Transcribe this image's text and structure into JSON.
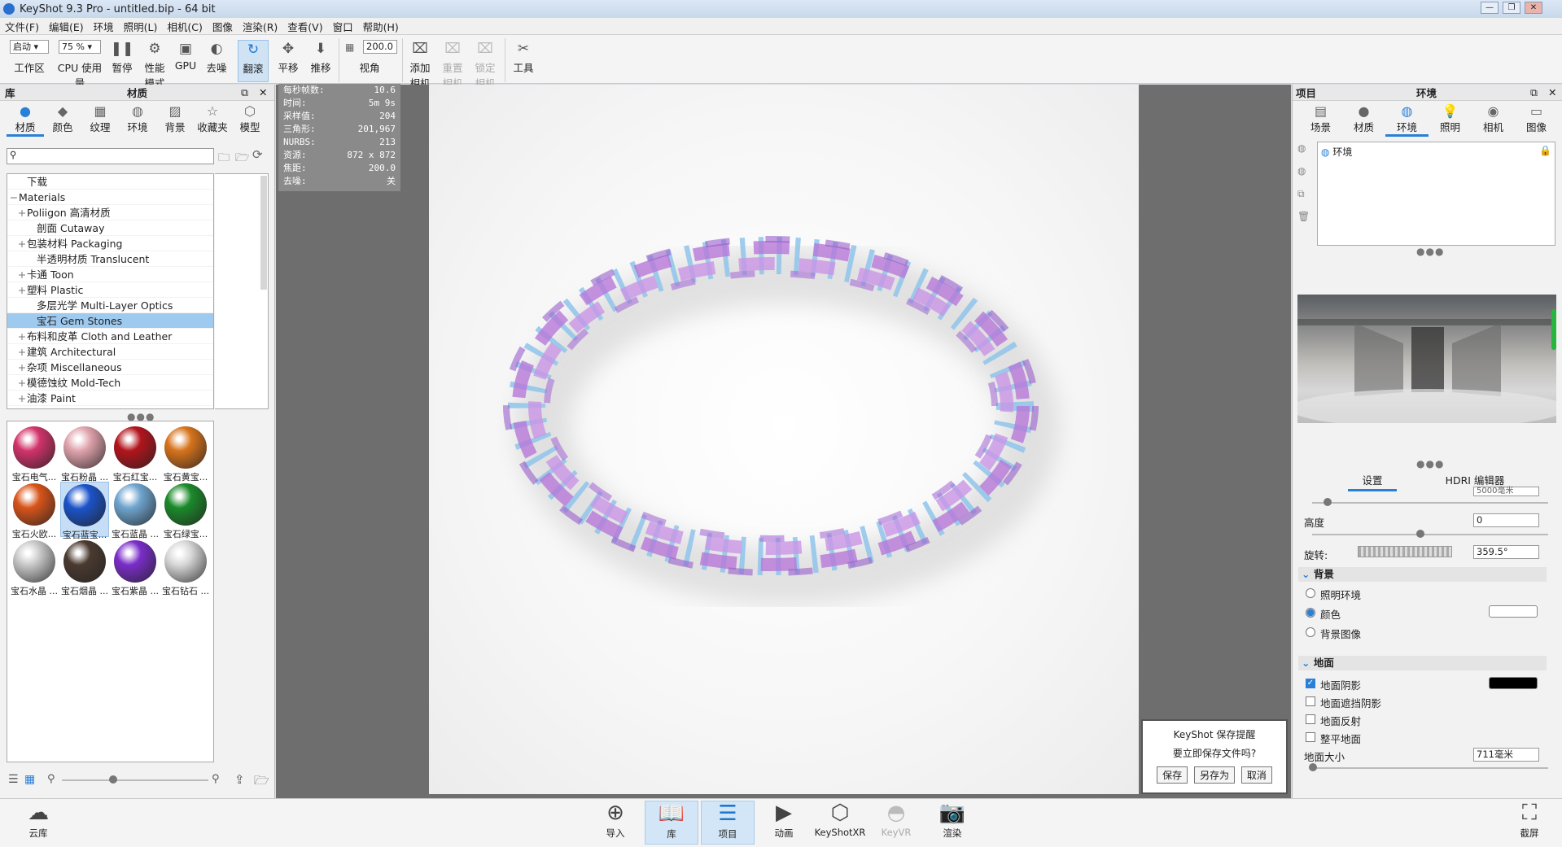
{
  "window": {
    "title": "KeyShot 9.3 Pro  - untitled.bip  - 64 bit"
  },
  "menu": [
    "文件(F)",
    "编辑(E)",
    "环境",
    "照明(L)",
    "相机(C)",
    "图像",
    "渲染(R)",
    "查看(V)",
    "窗口",
    "帮助(H)"
  ],
  "toolbar": {
    "workspace_select": "启动",
    "workspace_label": "工作区",
    "cpu_select": "75 %",
    "cpu_label": "CPU 使用量",
    "pause": "暂停",
    "perf_l1": "性能",
    "perf_l2": "模式",
    "gpu": "GPU",
    "denoise": "去噪",
    "tumble": "翻滚",
    "pan": "平移",
    "dolly": "推移",
    "fov_value": "200.0",
    "fov_label": "视角",
    "add_cam_l1": "添加",
    "add_cam_l2": "相机",
    "reset_cam_l1": "重置",
    "reset_cam_l2": "相机",
    "lock_cam_l1": "锁定",
    "lock_cam_l2": "相机",
    "tools": "工具"
  },
  "library": {
    "header_left": "库",
    "header_title": "材质",
    "tabs": [
      "材质",
      "颜色",
      "纹理",
      "环境",
      "背景",
      "收藏夹",
      "模型"
    ],
    "tree": [
      {
        "label": "下载",
        "plus": false,
        "indent": 1
      },
      {
        "label": "Materials",
        "plus": false,
        "indent": 0,
        "minus": true
      },
      {
        "label": "Poliigon 高清材质",
        "plus": true,
        "indent": 1
      },
      {
        "label": "剖面 Cutaway",
        "plus": false,
        "indent": 2
      },
      {
        "label": "包装材料 Packaging",
        "plus": true,
        "indent": 1
      },
      {
        "label": "半透明材质 Translucent",
        "plus": false,
        "indent": 2
      },
      {
        "label": "卡通 Toon",
        "plus": true,
        "indent": 1
      },
      {
        "label": "塑料 Plastic",
        "plus": true,
        "indent": 1
      },
      {
        "label": "多层光学 Multi-Layer Optics",
        "plus": false,
        "indent": 2
      },
      {
        "label": "宝石 Gem Stones",
        "plus": false,
        "indent": 2,
        "selected": true
      },
      {
        "label": "布料和皮革 Cloth and Leather",
        "plus": true,
        "indent": 1
      },
      {
        "label": "建筑 Architectural",
        "plus": true,
        "indent": 1
      },
      {
        "label": "杂项 Miscellaneous",
        "plus": true,
        "indent": 1
      },
      {
        "label": "模德蚀纹 Mold-Tech",
        "plus": true,
        "indent": 1
      },
      {
        "label": "油漆 Paint",
        "plus": true,
        "indent": 1
      }
    ],
    "swatches": [
      {
        "label": "宝石电气...",
        "color": "#d2336a"
      },
      {
        "label": "宝石粉晶 ...",
        "color": "#e0a3ad"
      },
      {
        "label": "宝石红宝...",
        "color": "#b3141c"
      },
      {
        "label": "宝石黄宝...",
        "color": "#d7731c"
      },
      {
        "label": "宝石火欧...",
        "color": "#d8541a"
      },
      {
        "label": "宝石蓝宝...",
        "color": "#1b53c9",
        "selected": true
      },
      {
        "label": "宝石蓝晶 ...",
        "color": "#6fa5cf"
      },
      {
        "label": "宝石绿宝...",
        "color": "#1b8a2a"
      },
      {
        "label": "宝石水晶 ...",
        "color": "#c9c9c9"
      },
      {
        "label": "宝石烟晶 ...",
        "color": "#4a3a30"
      },
      {
        "label": "宝石紫晶 ...",
        "color": "#7a2dc9"
      },
      {
        "label": "宝石钻石 ...",
        "color": "#d8d8d8"
      }
    ]
  },
  "stats": [
    {
      "k": "每秒帧数:",
      "v": "10.6"
    },
    {
      "k": "时间:",
      "v": "5m 9s"
    },
    {
      "k": "采样值:",
      "v": "204"
    },
    {
      "k": "三角形:",
      "v": "201,967"
    },
    {
      "k": "NURBS:",
      "v": "213"
    },
    {
      "k": "资源:",
      "v": "872 x 872"
    },
    {
      "k": "焦距:",
      "v": "200.0"
    },
    {
      "k": "去噪:",
      "v": "关"
    }
  ],
  "save_dialog": {
    "title": "KeyShot 保存提醒",
    "message": "要立即保存文件吗?",
    "save": "保存",
    "save_as": "另存为",
    "cancel": "取消"
  },
  "project": {
    "header_left": "项目",
    "header_title": "环境",
    "tabs": [
      "场景",
      "材质",
      "环境",
      "照明",
      "相机",
      "图像"
    ],
    "env_item": "环境",
    "subtabs": [
      "设置",
      "HDRI 编辑器"
    ],
    "size_value": "5000毫米",
    "height_label": "高度",
    "height_value": "0",
    "rotation_label": "旋转:",
    "rotation_value": "359.5°",
    "background_header": "背景",
    "bg_options": [
      "照明环境",
      "颜色",
      "背景图像"
    ],
    "ground_header": "地面",
    "ground_options": [
      {
        "label": "地面阴影",
        "checked": true
      },
      {
        "label": "地面遮挡阴影",
        "checked": false
      },
      {
        "label": "地面反射",
        "checked": false
      },
      {
        "label": "整平地面",
        "checked": false
      }
    ],
    "ground_size_label": "地面大小",
    "ground_size_value": "711毫米",
    "ground_shadow_color": "#000000",
    "bg_color": "#ffffff"
  },
  "bottombar": {
    "cloud": "云库",
    "buttons": [
      "导入",
      "库",
      "项目",
      "动画",
      "KeyShotXR",
      "KeyVR",
      "渲染"
    ],
    "screenshot": "截屏"
  },
  "colors": {
    "accent": "#2a7fd6",
    "dna_pink": "#c58be0",
    "dna_blue": "#6fb0e0"
  }
}
